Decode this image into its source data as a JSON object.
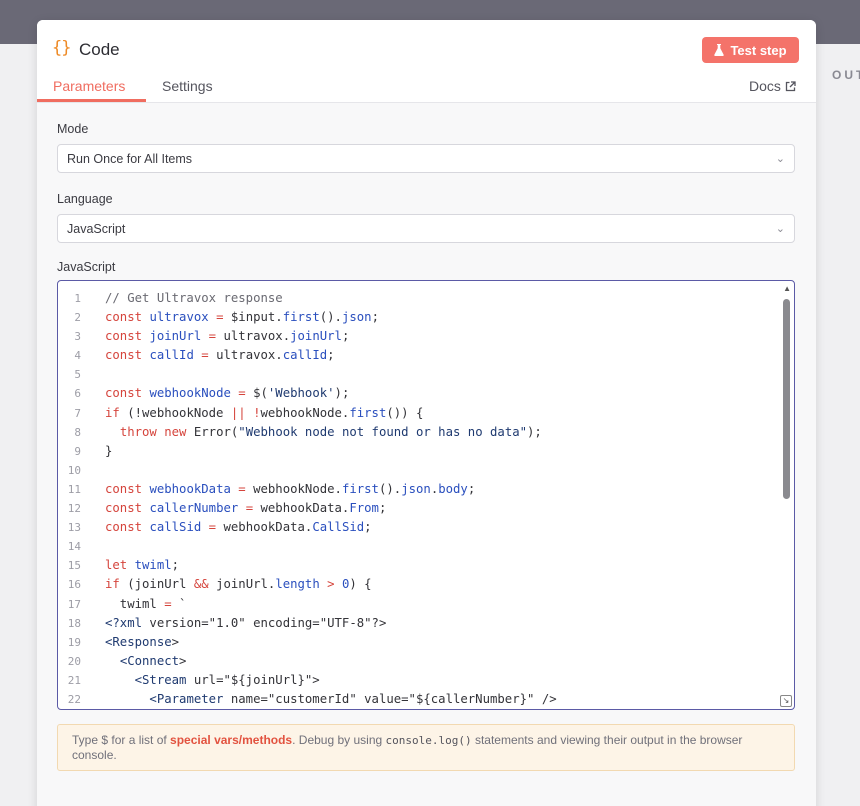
{
  "background": {
    "out_label": "OUT"
  },
  "header": {
    "icon": "{}",
    "title": "Code",
    "test_button": "Test step",
    "test_icon": "flask-icon",
    "tabs": [
      "Parameters",
      "Settings"
    ],
    "docs_label": "Docs",
    "docs_icon": "external-link-icon"
  },
  "fields": {
    "mode_label": "Mode",
    "mode_value": "Run Once for All Items",
    "language_label": "Language",
    "language_value": "JavaScript",
    "editor_label": "JavaScript"
  },
  "code_lines": [
    "// Get Ultravox response",
    "const ultravox = $input.first().json;",
    "const joinUrl = ultravox.joinUrl;",
    "const callId = ultravox.callId;",
    "",
    "const webhookNode = $('Webhook');",
    "if (!webhookNode || !webhookNode.first()) {",
    "  throw new Error(\"Webhook node not found or has no data\");",
    "}",
    "",
    "const webhookData = webhookNode.first().json.body;",
    "const callerNumber = webhookData.From;",
    "const callSid = webhookData.CallSid;",
    "",
    "let twiml;",
    "if (joinUrl && joinUrl.length > 0) {",
    "  twiml = `",
    "<?xml version=\"1.0\" encoding=\"UTF-8\"?>",
    "<Response>",
    "  <Connect>",
    "    <Stream url=\"${joinUrl}\">",
    "      <Parameter name=\"customerId\" value=\"${callerNumber}\" />"
  ],
  "hint": {
    "p1": "Type $ for a list of ",
    "link": "special vars/methods",
    "p2": ". Debug by using ",
    "code": "console.log()",
    "p3": " statements and viewing their output in the browser console."
  },
  "colors": {
    "accent": "#f06d60",
    "test_button": "#f4736a",
    "keyword": "#d5443c",
    "identifier": "#2a4fbe",
    "editor_border": "#5b5aa6"
  }
}
